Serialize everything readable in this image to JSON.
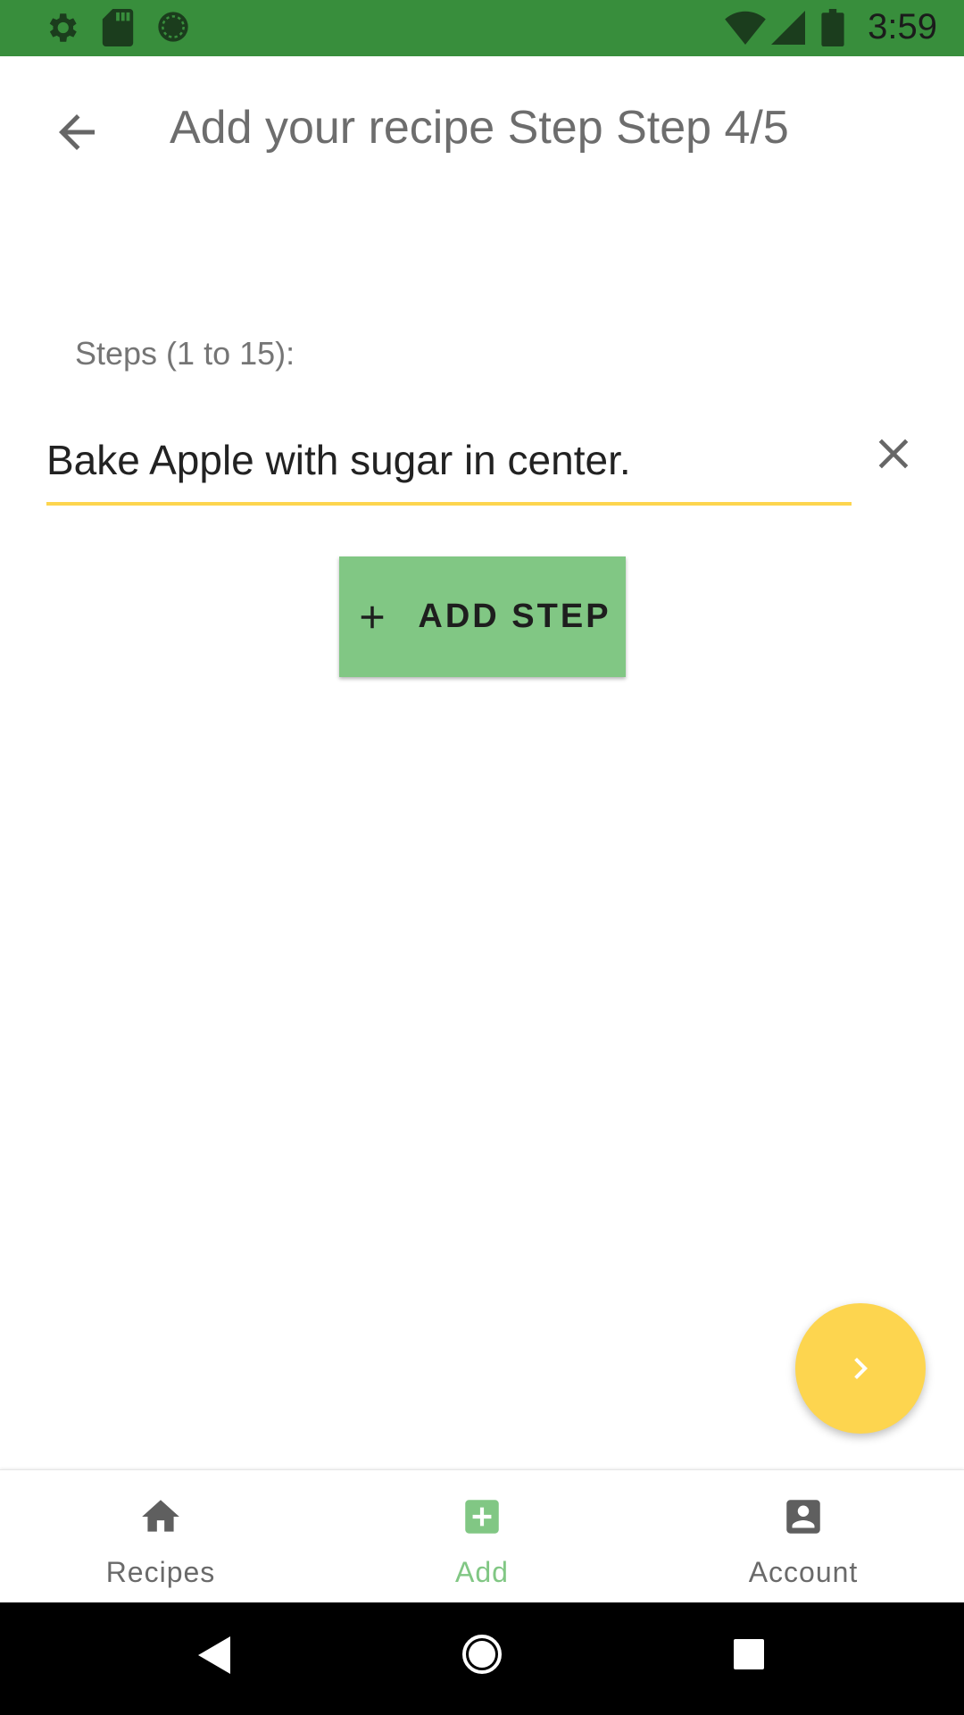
{
  "status_bar": {
    "time": "3:59",
    "icons": [
      "settings-icon",
      "sd-card-icon",
      "sync-icon",
      "wifi-icon",
      "signal-icon",
      "battery-icon"
    ]
  },
  "app_bar": {
    "title": "Add your recipe Step Step 4/5",
    "back_icon": "arrow-back-icon"
  },
  "steps": {
    "label": "Steps (1 to 15):",
    "items": [
      {
        "value": "Bake Apple with sugar in center."
      }
    ],
    "clear_icon": "close-icon",
    "add_button_label": "ADD STEP",
    "add_button_icon": "plus-icon"
  },
  "fab": {
    "icon": "chevron-right-icon"
  },
  "bottom_nav": {
    "items": [
      {
        "label": "Recipes",
        "icon": "home-icon",
        "active": false
      },
      {
        "label": "Add",
        "icon": "add-box-icon",
        "active": true
      },
      {
        "label": "Account",
        "icon": "account-box-icon",
        "active": false
      }
    ]
  },
  "system_nav": {
    "buttons": [
      "back-triangle-icon",
      "home-circle-icon",
      "recents-square-icon"
    ]
  },
  "colors": {
    "status_bar": "#388e3c",
    "accent_green": "#81c784",
    "accent_yellow": "#fdd54f",
    "text_grey": "#757575"
  }
}
